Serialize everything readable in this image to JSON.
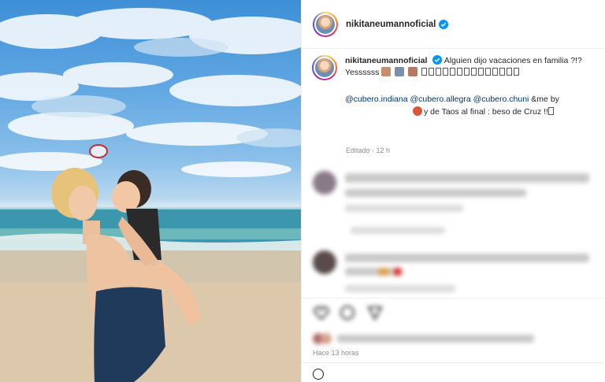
{
  "post": {
    "username": "nikitaneumannoficial",
    "verified_icon": "verified-badge-icon",
    "caption_username": "nikitaneumannoficial",
    "caption_line1": "Alguien dijo vacaciones en familia ?!?",
    "caption_line2_text": "Yessssss",
    "mention1": "@cubero.indiana",
    "mention2": "@cubero.allegra",
    "mention3": "@cubero.chuni",
    "mention_tail": " &me by",
    "caption_line4": "y de Taos al final : beso de Cruz !!",
    "edited": "Editado · 12 h",
    "timestamp": "Hace 13 horas"
  },
  "colors": {
    "link": "#00376b",
    "verified": "#0095f6",
    "muted": "#8e8e8e"
  }
}
